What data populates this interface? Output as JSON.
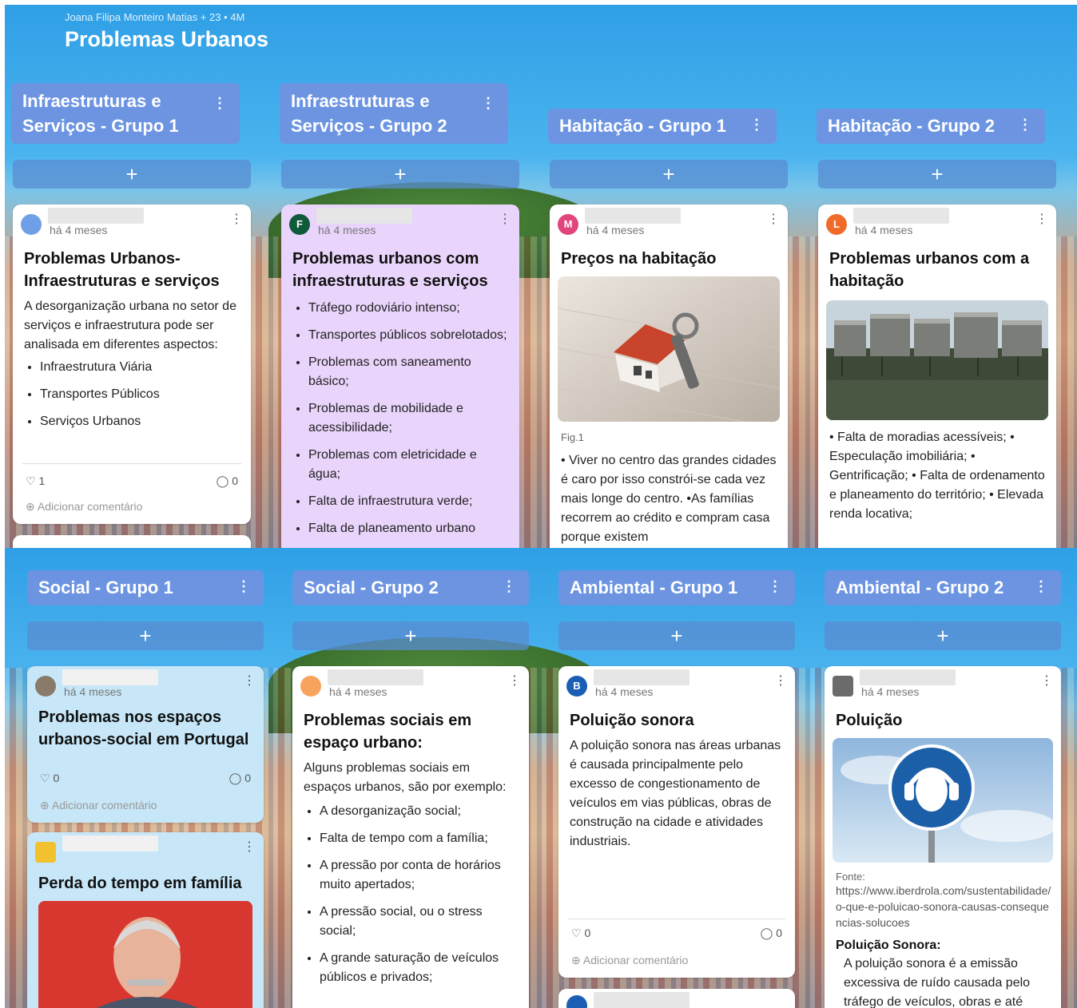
{
  "board": {
    "meta": "Joana Filipa Monteiro Matias + 23 • 4M",
    "title": "Problemas Urbanos"
  },
  "columns_top": [
    {
      "title": "Infraestruturas e Serviços - Grupo 1"
    },
    {
      "title": "Infraestruturas e Serviços - Grupo 2"
    },
    {
      "title": "Habitação - Grupo 1"
    },
    {
      "title": "Habitação - Grupo 2"
    }
  ],
  "columns_bottom": [
    {
      "title": "Social - Grupo 1"
    },
    {
      "title": "Social - Grupo 2"
    },
    {
      "title": "Ambiental - Grupo 1"
    },
    {
      "title": "Ambiental - Grupo 2"
    }
  ],
  "common": {
    "add": "+",
    "more": "⋮",
    "time": "há 4 meses",
    "add_comment": "Adicionar comentário"
  },
  "cards": {
    "infra1": {
      "title": "Problemas Urbanos- Infraestruturas e serviços",
      "body": "A desorganização urbana no setor de serviços e infraestrutura pode ser analisada em diferentes aspectos:",
      "items": [
        "Infraestrutura Viária",
        "Transportes Públicos",
        "Serviços Urbanos"
      ],
      "likes": "1",
      "comments": "0"
    },
    "infra2": {
      "avatar": "F",
      "title": "Problemas urbanos com infraestruturas e serviços",
      "items": [
        "Tráfego rodoviário intenso;",
        "Transportes públicos sobrelotados;",
        "Problemas com saneamento básico;",
        "Problemas de mobilidade e acessibilidade;",
        "Problemas com eletricidade e água;",
        "Falta de infraestrutura verde;",
        "Falta de planeamento urbano"
      ]
    },
    "hab1": {
      "avatar": "M",
      "title": "Preços na habitação",
      "caption": "Fig.1",
      "body": "• Viver no centro das grandes cidades é caro por isso constrói-se cada vez mais longe do centro. •As famílias recorrem ao crédito e compram casa porque existem"
    },
    "hab2": {
      "avatar": "L",
      "title": "Problemas urbanos com a habitação",
      "body": "• Falta de moradias acessíveis; • Especulação imobiliária; • Gentrificação; • Falta de ordenamento e planeamento do território; • Elevada renda locativa;"
    },
    "social1a": {
      "title": "Problemas nos espaços urbanos-social em Portugal",
      "likes": "0",
      "comments": "0"
    },
    "social1b": {
      "title": "Perda do tempo em família"
    },
    "social2": {
      "title": "Problemas sociais em espaço urbano:",
      "body": "Alguns problemas sociais em espaços urbanos, são por exemplo:",
      "items": [
        "A desorganização social;",
        "Falta de tempo com a família;",
        "A pressão por conta de horários muito apertados;",
        "A pressão social, ou o stress social;",
        "A grande saturação de veículos públicos e privados;"
      ]
    },
    "amb1": {
      "avatar": "B",
      "title": "Poluição sonora",
      "body": "A poluição sonora nas áreas urbanas é causada principalmente pelo excesso de congestionamento de veículos em vias públicas, obras de construção na cidade e atividades industriais.",
      "likes": "0",
      "comments": "0"
    },
    "amb2": {
      "title": "Poluição",
      "source_label": "Fonte:",
      "source_url": "https://www.iberdrola.com/sustentabilidade/o-que-e-poluicao-sonora-causas-consequencias-solucoes",
      "subtitle": "Poluição Sonora:",
      "body": "A poluição sonora é a emissão excessiva de ruído causada pelo tráfego de veículos, obras e até"
    }
  },
  "colors": {
    "header": "#6f92e0",
    "card_purple": "#e9d4fb",
    "card_lightblue": "#c7e7f8",
    "avatar_f": "#0f5a3a",
    "avatar_m": "#e0457b",
    "avatar_l": "#f06a2a",
    "avatar_b": "#1a5fb4"
  }
}
